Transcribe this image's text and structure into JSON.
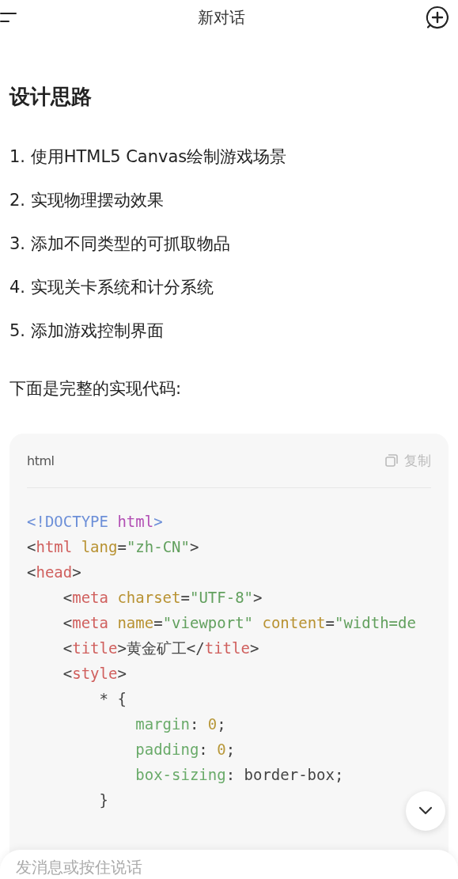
{
  "header": {
    "title": "新对话"
  },
  "message": {
    "heading": "设计思路",
    "steps": [
      "使用HTML5 Canvas绘制游戏场景",
      "实现物理摆动效果",
      "添加不同类型的可抓取物品",
      "实现关卡系统和计分系统",
      "添加游戏控制界面"
    ],
    "step_numbers": [
      "1.",
      "2.",
      "3.",
      "4.",
      "5."
    ],
    "intro": "下面是完整的实现代码:",
    "code_block": {
      "language": "html",
      "copy_label": "复制",
      "lines": [
        {
          "tokens": [
            {
              "kind": "doctype",
              "text": "<!DOCTYPE "
            },
            {
              "kind": "keyword",
              "text": "html"
            },
            {
              "kind": "doctype",
              "text": ">"
            }
          ]
        },
        {
          "tokens": [
            {
              "kind": "punct",
              "text": "<"
            },
            {
              "kind": "tag",
              "text": "html"
            },
            {
              "kind": "attr",
              "text": " lang"
            },
            {
              "kind": "punct",
              "text": "="
            },
            {
              "kind": "string",
              "text": "\"zh-CN\""
            },
            {
              "kind": "punct",
              "text": ">"
            }
          ]
        },
        {
          "tokens": [
            {
              "kind": "punct",
              "text": "<"
            },
            {
              "kind": "tag",
              "text": "head"
            },
            {
              "kind": "punct",
              "text": ">"
            }
          ]
        },
        {
          "tokens": [
            {
              "kind": "punct",
              "text": "    <"
            },
            {
              "kind": "tag",
              "text": "meta"
            },
            {
              "kind": "attr",
              "text": " charset"
            },
            {
              "kind": "punct",
              "text": "="
            },
            {
              "kind": "string",
              "text": "\"UTF-8\""
            },
            {
              "kind": "punct",
              "text": ">"
            }
          ]
        },
        {
          "tokens": [
            {
              "kind": "punct",
              "text": "    <"
            },
            {
              "kind": "tag",
              "text": "meta"
            },
            {
              "kind": "attr",
              "text": " name"
            },
            {
              "kind": "punct",
              "text": "="
            },
            {
              "kind": "string",
              "text": "\"viewport\""
            },
            {
              "kind": "attr",
              "text": " content"
            },
            {
              "kind": "punct",
              "text": "="
            },
            {
              "kind": "string",
              "text": "\"width=de"
            }
          ]
        },
        {
          "tokens": [
            {
              "kind": "punct",
              "text": "    <"
            },
            {
              "kind": "tag",
              "text": "title"
            },
            {
              "kind": "punct",
              "text": ">黄金矿工</"
            },
            {
              "kind": "tag",
              "text": "title"
            },
            {
              "kind": "punct",
              "text": ">"
            }
          ]
        },
        {
          "tokens": [
            {
              "kind": "punct",
              "text": "    <"
            },
            {
              "kind": "tag",
              "text": "style"
            },
            {
              "kind": "punct",
              "text": ">"
            }
          ]
        },
        {
          "tokens": [
            {
              "kind": "punct",
              "text": "        * {"
            }
          ]
        },
        {
          "tokens": [
            {
              "kind": "property",
              "text": "            margin"
            },
            {
              "kind": "punct",
              "text": ": "
            },
            {
              "kind": "number",
              "text": "0"
            },
            {
              "kind": "punct",
              "text": ";"
            }
          ]
        },
        {
          "tokens": [
            {
              "kind": "property",
              "text": "            padding"
            },
            {
              "kind": "punct",
              "text": ": "
            },
            {
              "kind": "number",
              "text": "0"
            },
            {
              "kind": "punct",
              "text": ";"
            }
          ]
        },
        {
          "tokens": [
            {
              "kind": "property",
              "text": "            box-sizing"
            },
            {
              "kind": "punct",
              "text": ": border-box;"
            }
          ]
        },
        {
          "tokens": [
            {
              "kind": "punct",
              "text": "        }"
            }
          ]
        }
      ]
    }
  },
  "composer": {
    "placeholder": "发消息或按住说话"
  }
}
